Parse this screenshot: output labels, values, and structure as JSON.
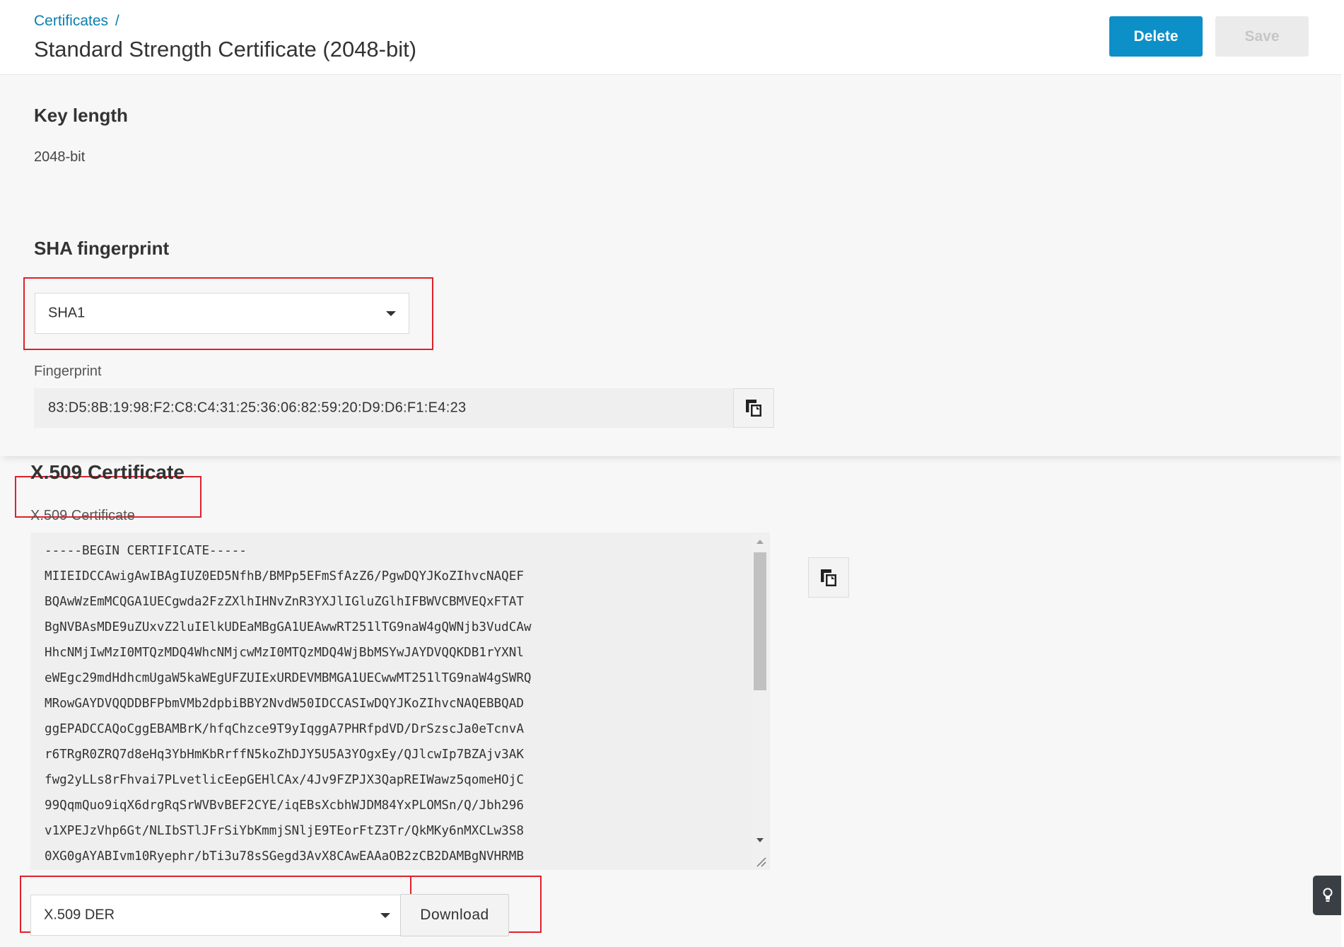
{
  "header": {
    "breadcrumb": "Certificates",
    "breadcrumb_sep": "/",
    "title": "Standard Strength Certificate (2048-bit)",
    "delete_label": "Delete",
    "save_label": "Save"
  },
  "key_length": {
    "heading": "Key length",
    "value": "2048-bit"
  },
  "sha": {
    "heading": "SHA fingerprint",
    "selected": "SHA1",
    "fingerprint_label": "Fingerprint",
    "fingerprint_value": "83:D5:8B:19:98:F2:C8:C4:31:25:36:06:82:59:20:D9:D6:F1:E4:23"
  },
  "x509": {
    "heading": "X.509 Certificate",
    "field_label": "X.509 Certificate",
    "lines": [
      "-----BEGIN CERTIFICATE-----",
      "MIIEIDCCAwigAwIBAgIUZ0ED5NfhB/BMPp5EFmSfAzZ6/PgwDQYJKoZIhvcNAQEF",
      "BQAwWzEmMCQGA1UECgwda2FzZXlhIHNvZnR3YXJlIGluZGlhIFBWVCBMVEQxFTAT",
      "BgNVBAsMDE9uZUxvZ2luIElkUDEaMBgGA1UEAwwRT251lTG9naW4gQWNjb3VudCAw",
      "HhcNMjIwMzI0MTQzMDQ4WhcNMjcwMzI0MTQzMDQ4WjBbMSYwJAYDVQQKDB1rYXNl",
      "eWEgc29mdHdhcmUgaW5kaWEgUFZUIExURDEVMBMGA1UECwwMT251lTG9naW4gSWRQ",
      "MRowGAYDVQQDDBFPbmVMb2dpbiBBY2NvdW50IDCCASIwDQYJKoZIhvcNAQEBBQAD",
      "ggEPADCCAQoCggEBAMBrK/hfqChzce9T9yIqggA7PHRfpdVD/DrSzscJa0eTcnvA",
      "r6TRgR0ZRQ7d8eHq3YbHmKbRrffN5koZhDJY5U5A3YOgxEy/QJlcwIp7BZAjv3AK",
      "fwg2yLLs8rFhvai7PLvetlicEepGEHlCAx/4Jv9FZPJX3QapREIWawz5qomeHOjC",
      "99QqmQuo9iqX6drgRqSrWVBvBEF2CYE/iqEBsXcbhWJDM84YxPLOMSn/Q/Jbh296",
      "v1XPEJzVhp6Gt/NLIbSTlJFrSiYbKmmjSNljE9TEorFtZ3Tr/QkMKy6nMXCLw3S8",
      "0XG0gAYABIvm10Ryephr/bTi3u78sSGegd3AvX8CAwEAAaOB2zCB2DAMBgNVHRMB"
    ],
    "format_selected": "X.509 DER",
    "download_label": "Download"
  },
  "icons": {
    "copy": "copy-icon",
    "lightbulb": "lightbulb-icon",
    "dropdown": "chevron-down-icon"
  },
  "colors": {
    "primary": "#0d8fc7",
    "link": "#0a7fb0",
    "highlight_box": "#e0202a"
  }
}
